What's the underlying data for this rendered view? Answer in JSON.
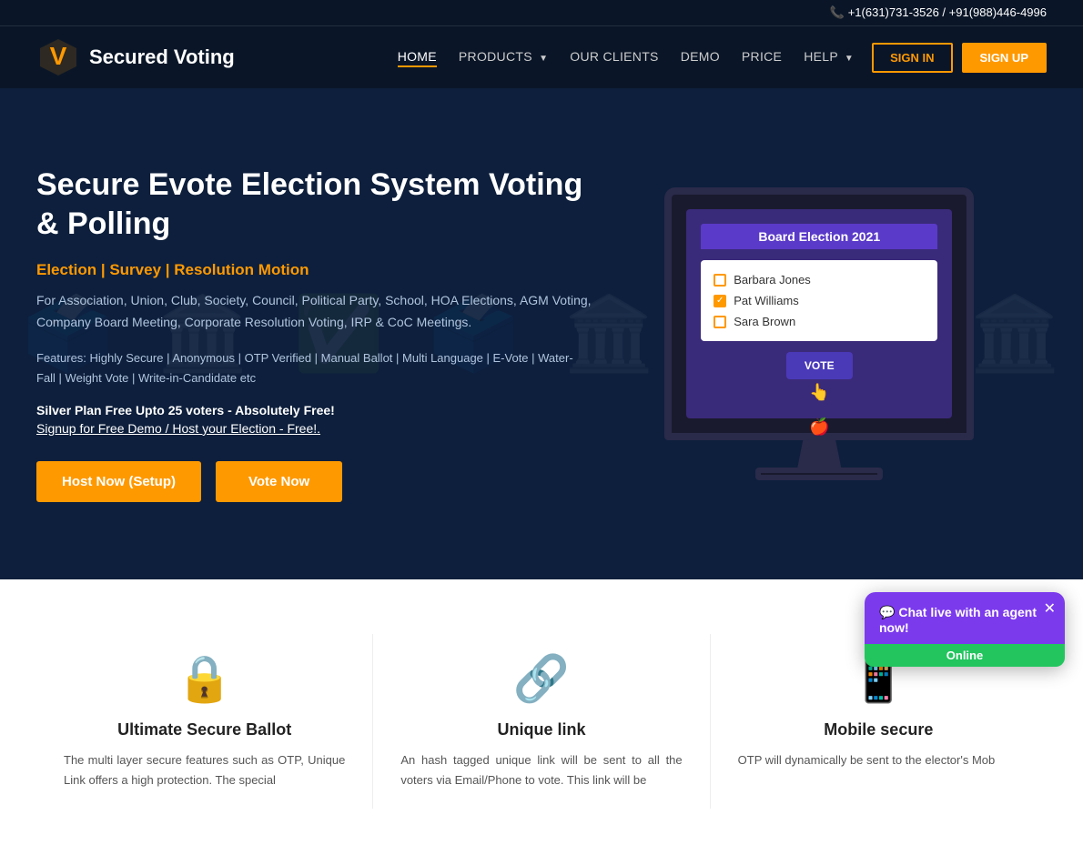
{
  "topbar": {
    "phone": "+1(631)731-3526 / +91(988)446-4996"
  },
  "logo": {
    "text": "Secured Voting"
  },
  "nav": {
    "links": [
      {
        "label": "HOME",
        "active": true
      },
      {
        "label": "PRODUCTS",
        "dropdown": true
      },
      {
        "label": "OUR CLIENTS",
        "active": false
      },
      {
        "label": "DEMO",
        "active": false
      },
      {
        "label": "PRICE",
        "active": false
      },
      {
        "label": "HELP",
        "dropdown": true
      }
    ],
    "signin": "SIGN IN",
    "signup": "SIGN UP"
  },
  "hero": {
    "title": "Secure Evote Election System Voting & Polling",
    "subtitle": "Election | Survey | Resolution Motion",
    "description": "For Association, Union, Club, Society, Council, Political Party, School, HOA Elections, AGM Voting, Company Board Meeting, Corporate Resolution Voting, IRP & CoC Meetings.",
    "features": "Features: Highly Secure | Anonymous | OTP Verified | Manual Ballot | Multi Language | E-Vote | Water-Fall | Weight Vote | Write-in-Candidate etc",
    "plan": "Silver Plan Free Upto 25 voters - Absolutely Free!",
    "signup_link": "Signup for Free Demo / Host your Election - Free!.",
    "cta_host": "Host Now (Setup)",
    "cta_vote": "Vote Now",
    "monitor": {
      "election_title": "Board Election 2021",
      "candidates": [
        {
          "name": "Barbara Jones",
          "checked": false
        },
        {
          "name": "Pat Williams",
          "checked": true
        },
        {
          "name": "Sara Brown",
          "checked": false
        }
      ],
      "vote_button": "VOTE"
    }
  },
  "features": [
    {
      "icon": "🔒",
      "title": "Ultimate Secure Ballot",
      "desc": "The multi layer secure features such as OTP, Unique Link offers a high protection. The special"
    },
    {
      "icon": "🔗",
      "title": "Unique link",
      "desc": "An hash tagged unique link will be sent to all the voters via Email/Phone to vote. This link will be"
    },
    {
      "icon": "📱",
      "title": "Mobile secure",
      "desc": "OTP will dynamically be sent to the elector's Mob"
    }
  ],
  "chat": {
    "message": "Chat live with an agent now!",
    "status": "Online"
  }
}
